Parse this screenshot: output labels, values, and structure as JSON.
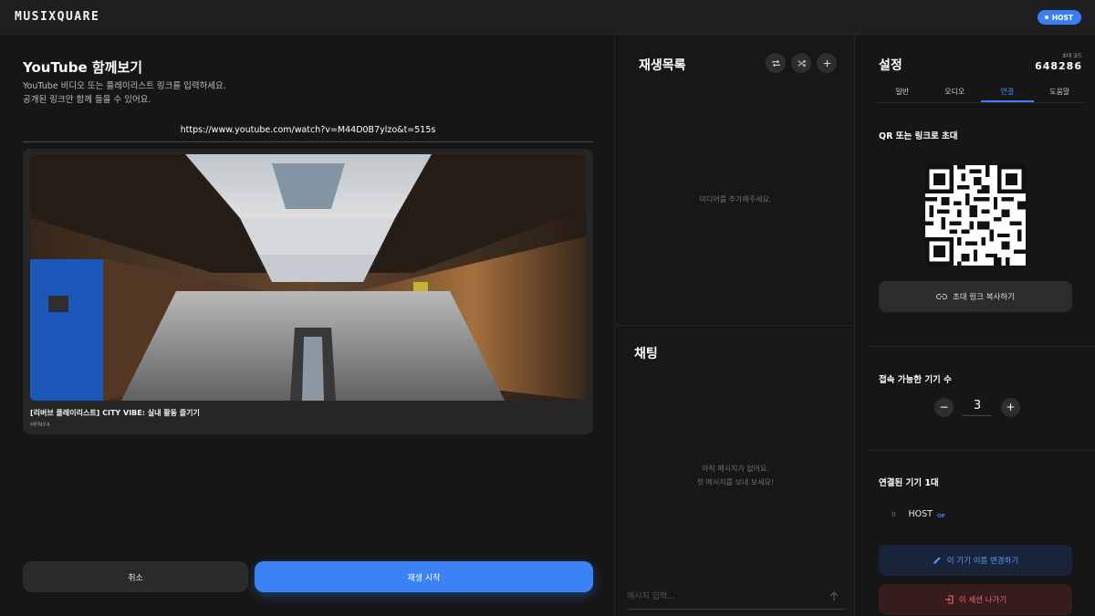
{
  "app": {
    "logo": "MUSIXQUARE",
    "role_badge": "HOST"
  },
  "youtube": {
    "title": "YouTube 함께보기",
    "desc_line1": "YouTube 비디오 또는 플레이리스트 링크를 입력하세요.",
    "desc_line2": "공개된 링크만 함께 들을 수 있어요.",
    "url_value": "https://www.youtube.com/watch?v=M44D0B7ylzo&t=515s",
    "video_title": "[리버브 플레이리스트] CITY VIBE: 실내 활동 즐기기",
    "video_channel": "HFNY4",
    "cancel_label": "취소",
    "play_label": "재생 시작"
  },
  "playlist": {
    "title": "재생목록",
    "empty_text": "미디어를 추가해주세요.",
    "icons": [
      "repeat-icon",
      "shuffle-icon",
      "plus-icon"
    ]
  },
  "chat": {
    "title": "채팅",
    "empty_line1": "아직 메시지가 없어요.",
    "empty_line2": "첫 메시지를 보내 보세요!",
    "input_placeholder": "메시지 입력..."
  },
  "settings": {
    "title": "설정",
    "invite_code_label": "초대 코드",
    "invite_code": "648286",
    "tabs": [
      {
        "label": "일반",
        "active": false
      },
      {
        "label": "오디오",
        "active": false
      },
      {
        "label": "연결",
        "active": true
      },
      {
        "label": "도움말",
        "active": false
      }
    ],
    "qr_title": "QR 또는 링크로 초대",
    "copy_link_label": "초대 링크 복사하기",
    "device_limit_title": "접속 가능한 기기 수",
    "device_limit_value": "3",
    "connected_title": "연결된 기기 1대",
    "devices": [
      {
        "index": "0",
        "name": "HOST",
        "tag": "OP"
      }
    ],
    "rename_label": "이 기기 이름 변경하기",
    "leave_label": "이 세션 나가기"
  },
  "colors": {
    "accent": "#3b82f6",
    "danger": "#ef6b6b",
    "background": "#161616"
  }
}
